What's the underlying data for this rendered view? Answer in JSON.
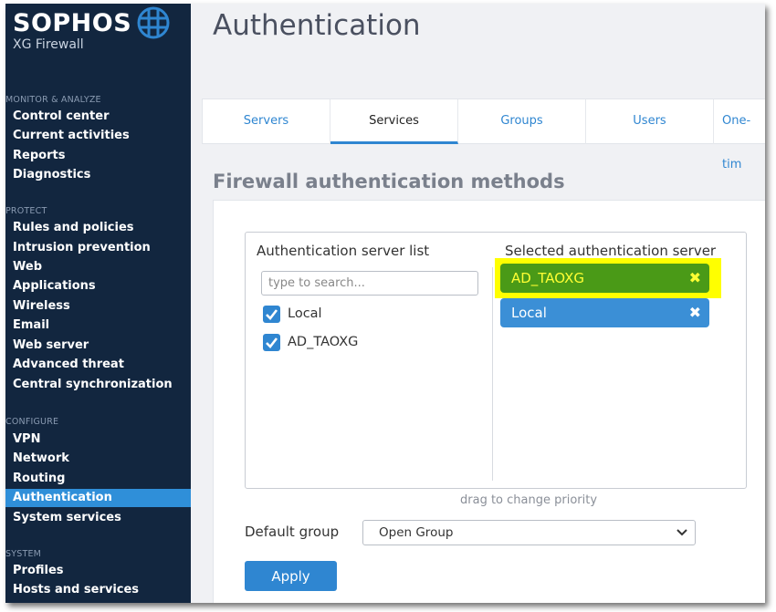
{
  "brand": {
    "name": "SOPHOS",
    "product": "XG Firewall"
  },
  "sidebar": {
    "sections": [
      {
        "label": "MONITOR & ANALYZE",
        "items": [
          "Control center",
          "Current activities",
          "Reports",
          "Diagnostics"
        ]
      },
      {
        "label": "PROTECT",
        "items": [
          "Rules and policies",
          "Intrusion prevention",
          "Web",
          "Applications",
          "Wireless",
          "Email",
          "Web server",
          "Advanced threat",
          "Central synchronization"
        ]
      },
      {
        "label": "CONFIGURE",
        "items": [
          "VPN",
          "Network",
          "Routing",
          "Authentication",
          "System services"
        ]
      },
      {
        "label": "SYSTEM",
        "items": [
          "Profiles",
          "Hosts and services"
        ]
      }
    ],
    "active_item": "Authentication"
  },
  "page": {
    "title": "Authentication"
  },
  "tabs": [
    {
      "label": "Servers",
      "active": false
    },
    {
      "label": "Services",
      "active": true
    },
    {
      "label": "Groups",
      "active": false
    },
    {
      "label": "Users",
      "active": false
    },
    {
      "label": "One-tim",
      "active": false
    }
  ],
  "section": {
    "title": "Firewall authentication methods"
  },
  "server_list": {
    "heading": "Authentication server list",
    "search_placeholder": "type to search...",
    "items": [
      {
        "label": "Local",
        "checked": true
      },
      {
        "label": "AD_TAOXG",
        "checked": true
      }
    ]
  },
  "selected_list": {
    "heading": "Selected authentication server",
    "items": [
      {
        "label": "AD_TAOXG",
        "color": "#4a9a17",
        "highlighted": true
      },
      {
        "label": "Local",
        "color": "#3b8fd6",
        "highlighted": false
      }
    ],
    "remove_icon": "close-icon",
    "highlight_color": "#ffff00"
  },
  "hint": "drag to change priority",
  "default_group": {
    "label": "Default group",
    "value": "Open Group"
  },
  "apply_label": "Apply",
  "colors": {
    "sidebar_bg": "#12263f",
    "accent": "#2f86d1",
    "active_nav": "#2f8fd9"
  }
}
